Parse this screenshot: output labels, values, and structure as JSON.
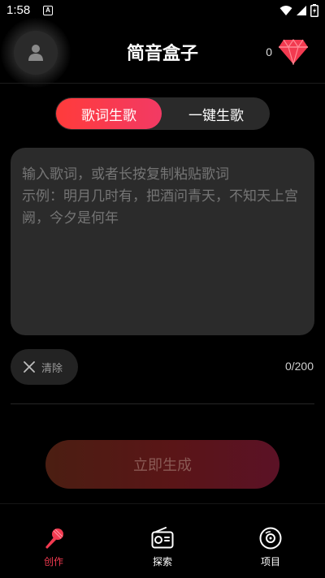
{
  "status_bar": {
    "time": "1:58",
    "notification_icon": "A"
  },
  "header": {
    "title": "简音盒子",
    "gem_count": "0"
  },
  "tabs": {
    "active": "歌词生歌",
    "inactive": "一键生歌"
  },
  "lyrics": {
    "placeholder": "输入歌词，或者长按复制粘贴歌词\n示例：明月几时有，把酒问青天，不知天上宫阙，今夕是何年",
    "value": ""
  },
  "clear": {
    "label": "清除"
  },
  "char_count": "0/200",
  "generate_button": "立即生成",
  "bottom_nav": {
    "create": "创作",
    "explore": "探索",
    "project": "项目"
  },
  "colors": {
    "accent": "#f23a50",
    "background": "#000000",
    "surface": "#2b2b2b"
  }
}
